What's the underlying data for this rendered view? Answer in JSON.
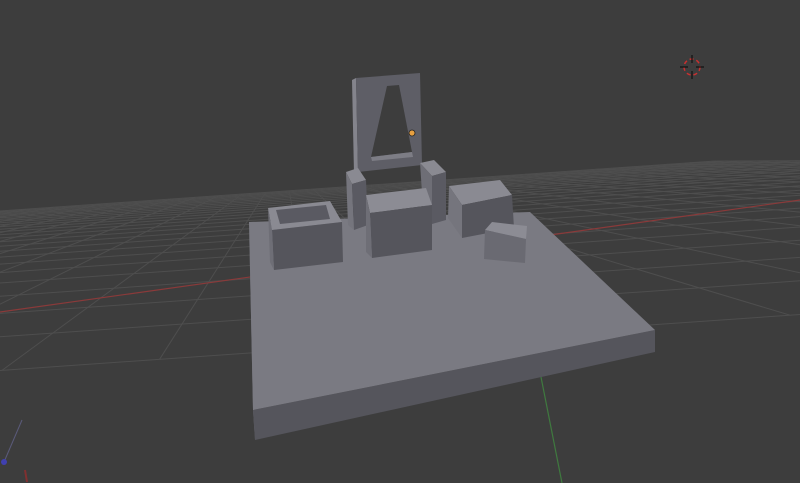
{
  "viewport": {
    "background": "#3d3d3d",
    "grid_color": "#4e4e4e",
    "x_axis_color": "#8a3a3a",
    "y_axis_color": "#3f7a3f",
    "origin_color": "#e8a040",
    "cursor_color": "#c83030"
  }
}
